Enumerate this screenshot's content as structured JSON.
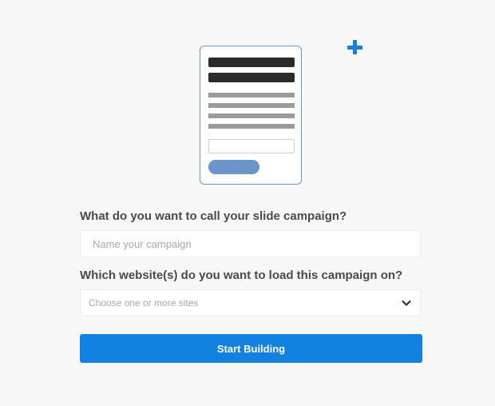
{
  "form": {
    "name_label": "What do you want to call your slide campaign?",
    "name_placeholder": "Name your campaign",
    "name_value": "",
    "site_label": "Which website(s) do you want to load this campaign on?",
    "site_placeholder": "Choose one or more sites",
    "submit_label": "Start Building"
  },
  "icons": {
    "illustration": "slide-campaign-illustration",
    "plus": "plus-icon",
    "dropdown": "chevron-down-icon"
  },
  "colors": {
    "accent": "#1381e0",
    "illustration_outline": "#6b94c9",
    "background": "#f7f7f8"
  }
}
